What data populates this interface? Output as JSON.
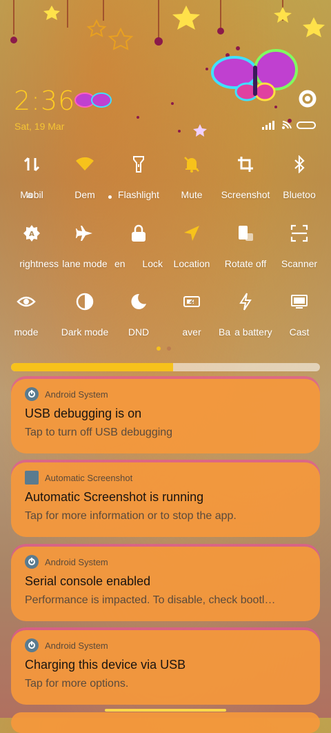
{
  "status": {
    "time": "2:36",
    "date": "Sat, 19 Mar"
  },
  "quick_tiles": {
    "row1": [
      {
        "label": "a",
        "icon": "data-icon",
        "active": false
      },
      {
        "label": "Mobil",
        "icon": "mobile-data-icon",
        "active": false
      },
      {
        "label": "Dem",
        "icon": "wifi-icon",
        "active": true
      },
      {
        "label": "Flashlight",
        "icon": "flashlight-icon",
        "active": false
      },
      {
        "label": "Mute",
        "icon": "bell-off-icon",
        "active": true
      },
      {
        "label": "Screenshot",
        "icon": "crop-icon",
        "active": false
      },
      {
        "label": "Bluetoo",
        "icon": "bluetooth-icon",
        "active": false
      }
    ],
    "row2": [
      {
        "label": "rightness",
        "icon": "auto-brightness-icon",
        "active": false
      },
      {
        "label": "lane mode",
        "icon": "airplane-icon",
        "active": false
      },
      {
        "label": "en",
        "icon": "lock-icon",
        "active": false
      },
      {
        "label": "Lock",
        "icon": "lock-icon",
        "active": false
      },
      {
        "label": "Location",
        "icon": "location-arrow-icon",
        "active": true
      },
      {
        "label": "Rotate off",
        "icon": "rotate-icon",
        "active": false
      },
      {
        "label": "Scanner",
        "icon": "scanner-icon",
        "active": false
      }
    ],
    "row3": [
      {
        "label": "mode",
        "icon": "eye-icon",
        "active": false
      },
      {
        "label": "Dark mode",
        "icon": "dark-mode-icon",
        "active": false
      },
      {
        "label": "DND",
        "icon": "moon-icon",
        "active": false
      },
      {
        "label": "aver",
        "icon": "battery-saver-icon",
        "active": false
      },
      {
        "label": "Ba",
        "icon": "lightning-icon",
        "active": false
      },
      {
        "label": "a battery sa",
        "icon": "lightning-icon",
        "active": false
      },
      {
        "label": "Cast",
        "icon": "cast-icon",
        "active": false
      }
    ]
  },
  "pager": {
    "pages": 2,
    "current": 1
  },
  "brightness": {
    "level": 0.525
  },
  "colors": {
    "accent": "#f7c21b",
    "clock": "#ffcc22",
    "card": "#f5983c"
  },
  "notifications": [
    {
      "app": "Android System",
      "title": "USB debugging is on",
      "text": "Tap to turn off USB debugging"
    },
    {
      "app": "Automatic Screenshot",
      "title": "Automatic Screenshot is running",
      "text": "Tap for more information or to stop the app."
    },
    {
      "app": "Android System",
      "title": "Serial console enabled",
      "text": "Performance is impacted. To disable, check bootl…"
    },
    {
      "app": "Android System",
      "title": "Charging this device via USB",
      "text": "Tap for more options."
    }
  ]
}
